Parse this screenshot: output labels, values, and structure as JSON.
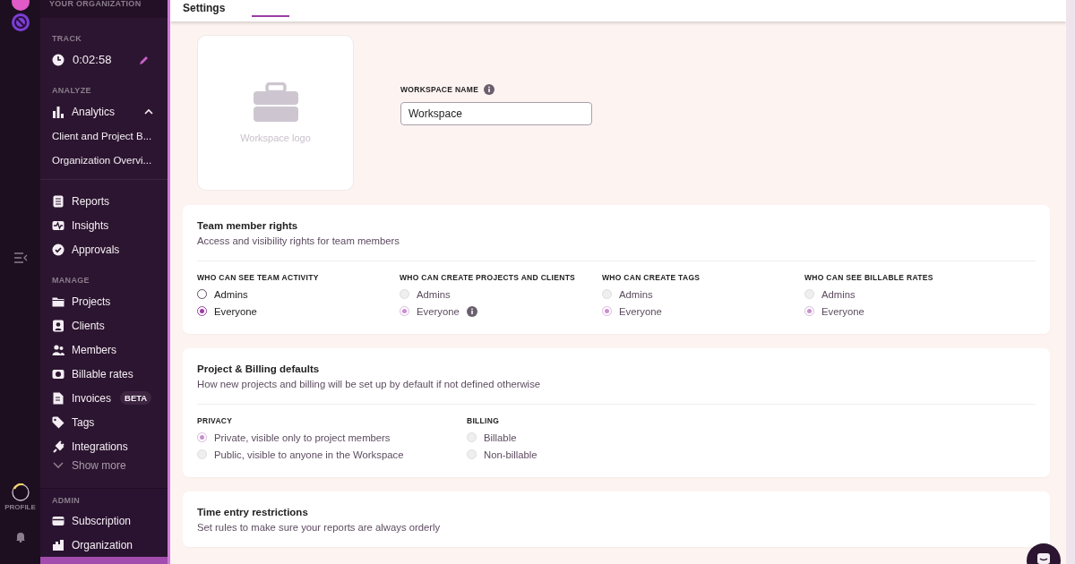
{
  "rail": {
    "profile_label": "PROFILE"
  },
  "sidebar": {
    "org_header": "YOUR ORGANIZATION",
    "sections": [
      {
        "heading": "TRACK",
        "items": [
          {
            "kind": "timer",
            "label": "0:02:58"
          }
        ]
      },
      {
        "heading": "ANALYZE",
        "items": [
          {
            "kind": "group",
            "label": "Analytics",
            "expanded": true
          },
          {
            "kind": "sub",
            "label": "Client and Project B..."
          },
          {
            "kind": "sub",
            "label": "Organization Overvi..."
          },
          {
            "kind": "divider"
          },
          {
            "kind": "item",
            "label": "Reports"
          },
          {
            "kind": "item",
            "label": "Insights"
          },
          {
            "kind": "item",
            "label": "Approvals"
          }
        ]
      },
      {
        "heading": "MANAGE",
        "items": [
          {
            "kind": "item",
            "label": "Projects"
          },
          {
            "kind": "item",
            "label": "Clients"
          },
          {
            "kind": "item",
            "label": "Members"
          },
          {
            "kind": "item",
            "label": "Billable rates"
          },
          {
            "kind": "item",
            "label": "Invoices",
            "badge": "BETA"
          },
          {
            "kind": "item",
            "label": "Tags"
          },
          {
            "kind": "item",
            "label": "Integrations"
          },
          {
            "kind": "more",
            "label": "Show more"
          }
        ]
      }
    ],
    "admin": {
      "heading": "ADMIN",
      "items": [
        {
          "label": "Subscription",
          "selected": false
        },
        {
          "label": "Organization",
          "selected": false
        },
        {
          "selected": true
        }
      ]
    }
  },
  "header": {
    "title": "Settings"
  },
  "workspace": {
    "logo_label": "Workspace logo",
    "name_label": "WORKSPACE NAME",
    "name_value": "Workspace"
  },
  "cards": [
    {
      "title": "Team member rights",
      "subtitle": "Access and visibility rights for team members",
      "groups": [
        {
          "label": "WHO CAN SEE TEAM ACTIVITY",
          "options": [
            {
              "label": "Admins",
              "selected": false,
              "disabled": false
            },
            {
              "label": "Everyone",
              "selected": true,
              "disabled": false
            }
          ]
        },
        {
          "label": "WHO CAN CREATE PROJECTS AND CLIENTS",
          "options": [
            {
              "label": "Admins",
              "selected": false,
              "disabled": true
            },
            {
              "label": "Everyone",
              "selected": true,
              "disabled": true,
              "info": true
            }
          ]
        },
        {
          "label": "WHO CAN CREATE TAGS",
          "options": [
            {
              "label": "Admins",
              "selected": false,
              "disabled": true
            },
            {
              "label": "Everyone",
              "selected": true,
              "disabled": true
            }
          ]
        },
        {
          "label": "WHO CAN SEE BILLABLE RATES",
          "options": [
            {
              "label": "Admins",
              "selected": false,
              "disabled": true
            },
            {
              "label": "Everyone",
              "selected": true,
              "disabled": true
            }
          ]
        }
      ]
    },
    {
      "title": "Project & Billing defaults",
      "subtitle": "How new projects and billing will be set up by default if not defined otherwise",
      "groups": [
        {
          "label": "PRIVACY",
          "options": [
            {
              "label": "Private, visible only to project members",
              "selected": true,
              "disabled": true
            },
            {
              "label": "Public, visible to anyone in the Workspace",
              "selected": false,
              "disabled": true
            }
          ]
        },
        {
          "label": "BILLING",
          "options": [
            {
              "label": "Billable",
              "selected": false,
              "disabled": true
            },
            {
              "label": "Non-billable",
              "selected": false,
              "disabled": true
            }
          ]
        }
      ]
    },
    {
      "title": "Time entry restrictions",
      "subtitle": "Set rules to make sure your reports are always orderly"
    }
  ]
}
